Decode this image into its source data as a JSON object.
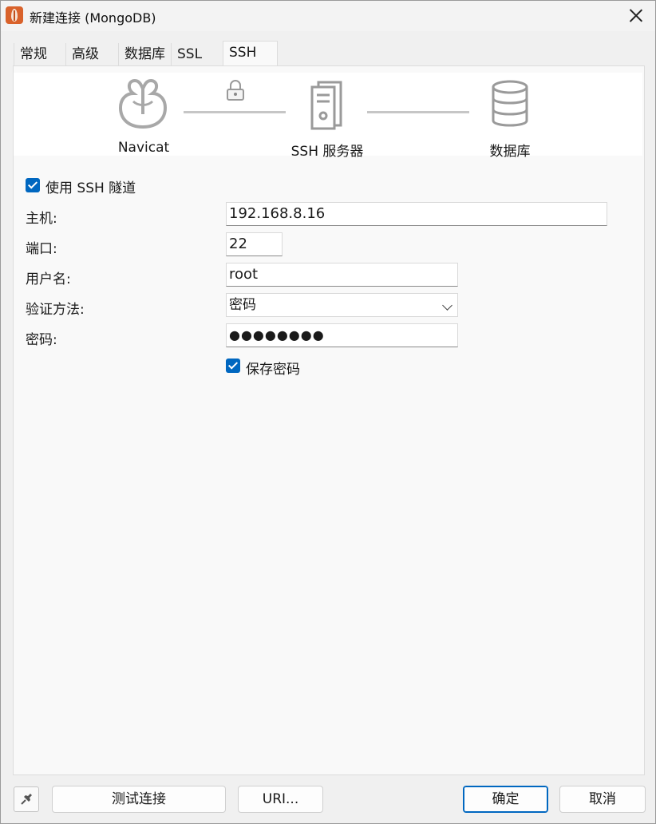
{
  "window": {
    "title": "新建连接 (MongoDB)"
  },
  "tabs": [
    {
      "label": "常规",
      "active": false
    },
    {
      "label": "高级",
      "active": false
    },
    {
      "label": "数据库",
      "active": false
    },
    {
      "label": "SSL",
      "active": false
    },
    {
      "label": "SSH",
      "active": true
    }
  ],
  "diagram": {
    "client_label": "Navicat",
    "server_label": "SSH 服务器",
    "database_label": "数据库",
    "client_icon": "navicat-logo-icon",
    "server_icon": "server-icon",
    "database_icon": "database-icon",
    "lock_icon": "lock-icon"
  },
  "ssh": {
    "use_tunnel_label": "使用 SSH 隧道",
    "use_tunnel_checked": true,
    "host_label": "主机:",
    "host_value": "192.168.8.16",
    "port_label": "端口:",
    "port_value": "22",
    "username_label": "用户名:",
    "username_value": "root",
    "auth_label": "验证方法:",
    "auth_value": "密码",
    "password_label": "密码:",
    "password_value": "●●●●●●●●",
    "save_password_label": "保存密码",
    "save_password_checked": true
  },
  "footer": {
    "test_label": "测试连接",
    "uri_label": "URI...",
    "ok_label": "确定",
    "cancel_label": "取消",
    "pin_icon": "pin-icon"
  },
  "colors": {
    "accent": "#0067c0",
    "app_icon": "#d9622b"
  }
}
